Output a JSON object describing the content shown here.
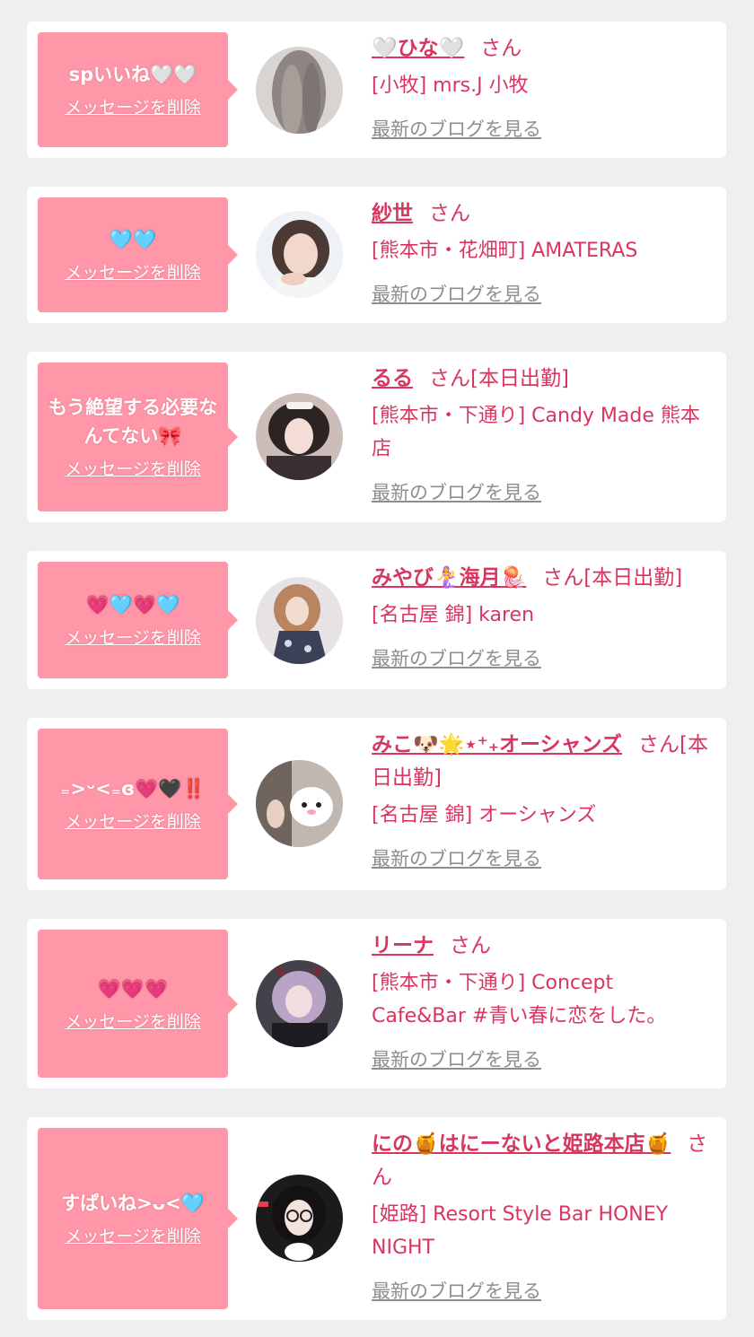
{
  "delete_label": "メッセージを削除",
  "san_label": "さん",
  "blog_label": "最新のブログを見る",
  "colors": {
    "bubble": "#ff97a8",
    "accent": "#d9365f",
    "muted": "#8e8e8e",
    "background": "#efefef"
  },
  "items": [
    {
      "message": "spいいね🤍🤍",
      "name": "🤍ひな🤍",
      "status": "",
      "shop": "[小牧] mrs.J 小牧",
      "avatar": "photo"
    },
    {
      "message": "🩵🩵",
      "name": "紗世",
      "status": "",
      "shop": "[熊本市・花畑町] AMATERAS",
      "avatar": "photo"
    },
    {
      "message": "もう絶望する必要なんてない🎀",
      "name": "るる",
      "status": "[本日出勤]",
      "shop": "[熊本市・下通り] Candy Made 熊本店",
      "avatar": "photo"
    },
    {
      "message": "💗🩵💗🩵",
      "name": "みやび🧜‍♀️海月🪼",
      "status": "[本日出勤]",
      "shop": "[名古屋 錦] karen",
      "avatar": "photo"
    },
    {
      "message": "₌>ᵕ<₌ɞ💗🖤‼️",
      "name": "みこ🐶🌟⋆⁺₊オーシャンズ",
      "status": "[本日出勤]",
      "shop": "[名古屋 錦] オーシャンズ",
      "avatar": "photo"
    },
    {
      "message": "💗💗💗",
      "name": "リーナ",
      "status": "",
      "shop": "[熊本市・下通り] Concept Cafe&Bar #青い春に恋をした。",
      "avatar": "photo"
    },
    {
      "message": "すぱいね>ᴗ<🩵",
      "name": "にの🍯はにーないと姫路本店🍯",
      "status": "",
      "shop": "[姫路] Resort Style Bar HONEY NIGHT",
      "avatar": "photo"
    }
  ]
}
